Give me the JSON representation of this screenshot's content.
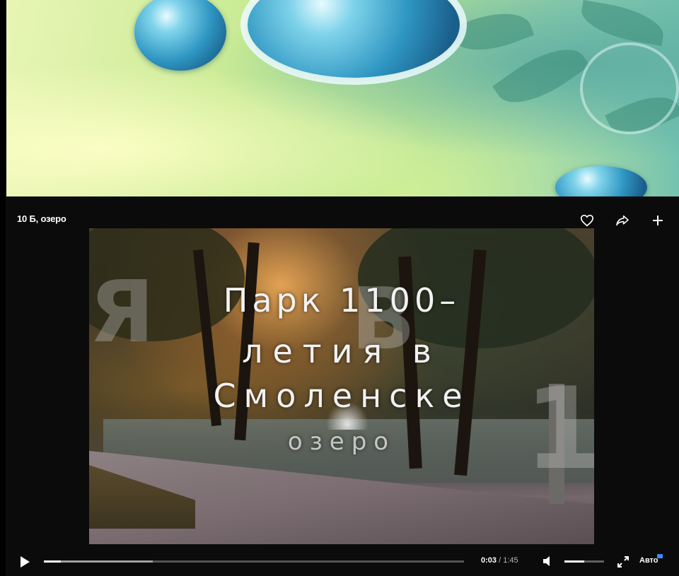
{
  "player": {
    "title": "10 Б, озеро",
    "actions": {
      "like_icon": "heart-icon",
      "share_icon": "share-icon",
      "add_icon": "plus-icon"
    },
    "video_text": {
      "line1": "Парк 1100–",
      "line2": "летия в",
      "line3": "Смоленске",
      "line4": "озеро"
    },
    "controls": {
      "current_time": "0:03",
      "separator": "/",
      "duration": "1:45",
      "played_fraction": 0.04,
      "buffered_fraction": 0.26,
      "volume_fraction": 0.5,
      "quality_label": "Авто"
    }
  },
  "colors": {
    "accent": "#3d8cff",
    "player_bg": "#0b0b0b"
  }
}
